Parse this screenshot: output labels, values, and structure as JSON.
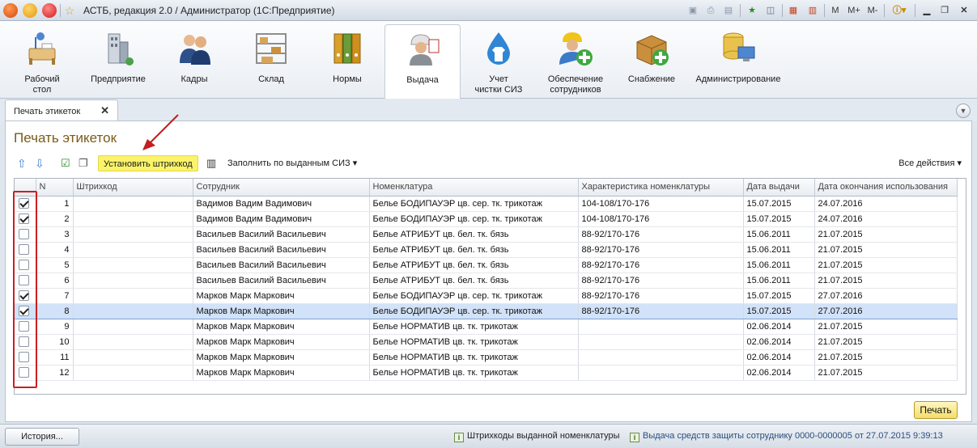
{
  "window": {
    "title": "АСТБ, редакция 2.0 / Администратор (1С:Предприятие)",
    "menu_m": "M",
    "menu_mplus": "M+",
    "menu_mminus": "M-"
  },
  "sections": [
    {
      "label": "Рабочий\nстол",
      "icon": "desk-icon"
    },
    {
      "label": "Предприятие",
      "icon": "building-icon"
    },
    {
      "label": "Кадры",
      "icon": "people-icon"
    },
    {
      "label": "Склад",
      "icon": "warehouse-shelf-icon"
    },
    {
      "label": "Нормы",
      "icon": "binders-icon"
    },
    {
      "label": "Выдача",
      "icon": "worker-issue-icon"
    },
    {
      "label": "Учет\nчистки СИЗ",
      "icon": "cleaning-drop-icon"
    },
    {
      "label": "Обеспечение\nсотрудников",
      "icon": "worker-add-icon"
    },
    {
      "label": "Снабжение",
      "icon": "box-add-icon"
    },
    {
      "label": "Администрирование",
      "icon": "database-computer-icon"
    }
  ],
  "tab": {
    "label": "Печать этикеток",
    "close": "✕"
  },
  "form": {
    "title": "Печать этикеток",
    "toolbar": {
      "set_barcode": "Установить штрихкод",
      "fill_by_issued": "Заполнить по выданным СИЗ",
      "all_actions": "Все действия"
    },
    "print_button": "Печать"
  },
  "table": {
    "columns": [
      "N",
      "Штрихкод",
      "Сотрудник",
      "Номенклатура",
      "Характеристика номенклатуры",
      "Дата выдачи",
      "Дата окончания использования"
    ],
    "rows": [
      {
        "checked": true,
        "n": "1",
        "barcode": "",
        "employee": "Вадимов Вадим Вадимович",
        "item": "Белье БОДИПАУЭР цв. сер. тк. трикотаж",
        "feature": "104-108/170-176",
        "issued": "15.07.2015",
        "end": "24.07.2016"
      },
      {
        "checked": true,
        "n": "2",
        "barcode": "",
        "employee": "Вадимов Вадим Вадимович",
        "item": "Белье БОДИПАУЭР цв. сер. тк. трикотаж",
        "feature": "104-108/170-176",
        "issued": "15.07.2015",
        "end": "24.07.2016"
      },
      {
        "checked": false,
        "n": "3",
        "barcode": "",
        "employee": "Васильев Василий Васильевич",
        "item": "Белье АТРИБУТ цв. бел. тк. бязь",
        "feature": "88-92/170-176",
        "issued": "15.06.2011",
        "end": "21.07.2015"
      },
      {
        "checked": false,
        "n": "4",
        "barcode": "",
        "employee": "Васильев Василий Васильевич",
        "item": "Белье АТРИБУТ цв. бел. тк. бязь",
        "feature": "88-92/170-176",
        "issued": "15.06.2011",
        "end": "21.07.2015"
      },
      {
        "checked": false,
        "n": "5",
        "barcode": "",
        "employee": "Васильев Василий Васильевич",
        "item": "Белье АТРИБУТ цв. бел. тк. бязь",
        "feature": "88-92/170-176",
        "issued": "15.06.2011",
        "end": "21.07.2015"
      },
      {
        "checked": false,
        "n": "6",
        "barcode": "",
        "employee": "Васильев Василий Васильевич",
        "item": "Белье АТРИБУТ цв. бел. тк. бязь",
        "feature": "88-92/170-176",
        "issued": "15.06.2011",
        "end": "21.07.2015"
      },
      {
        "checked": true,
        "n": "7",
        "barcode": "",
        "employee": "Марков Марк Маркович",
        "item": "Белье БОДИПАУЭР цв. сер. тк. трикотаж",
        "feature": "88-92/170-176",
        "issued": "15.07.2015",
        "end": "27.07.2016"
      },
      {
        "checked": true,
        "n": "8",
        "barcode": "",
        "employee": "Марков Марк Маркович",
        "item": "Белье БОДИПАУЭР цв. сер. тк. трикотаж",
        "feature": "88-92/170-176",
        "issued": "15.07.2015",
        "end": "27.07.2016",
        "selected": true
      },
      {
        "checked": false,
        "n": "9",
        "barcode": "",
        "employee": "Марков Марк Маркович",
        "item": "Белье НОРМАТИВ цв. тк. трикотаж",
        "feature": "",
        "issued": "02.06.2014",
        "end": "21.07.2015"
      },
      {
        "checked": false,
        "n": "10",
        "barcode": "",
        "employee": "Марков Марк Маркович",
        "item": "Белье НОРМАТИВ цв. тк. трикотаж",
        "feature": "",
        "issued": "02.06.2014",
        "end": "21.07.2015"
      },
      {
        "checked": false,
        "n": "11",
        "barcode": "",
        "employee": "Марков Марк Маркович",
        "item": "Белье НОРМАТИВ цв. тк. трикотаж",
        "feature": "",
        "issued": "02.06.2014",
        "end": "21.07.2015"
      },
      {
        "checked": false,
        "n": "12",
        "barcode": "",
        "employee": "Марков Марк Маркович",
        "item": "Белье НОРМАТИВ цв. тк. трикотаж",
        "feature": "",
        "issued": "02.06.2014",
        "end": "21.07.2015"
      }
    ]
  },
  "statusbar": {
    "history": "История...",
    "link1": "Штрихкоды выданной номенклатуры",
    "link2": "Выдача средств защиты сотруднику 0000-0000005 от 27.07.2015 9:39:13"
  }
}
